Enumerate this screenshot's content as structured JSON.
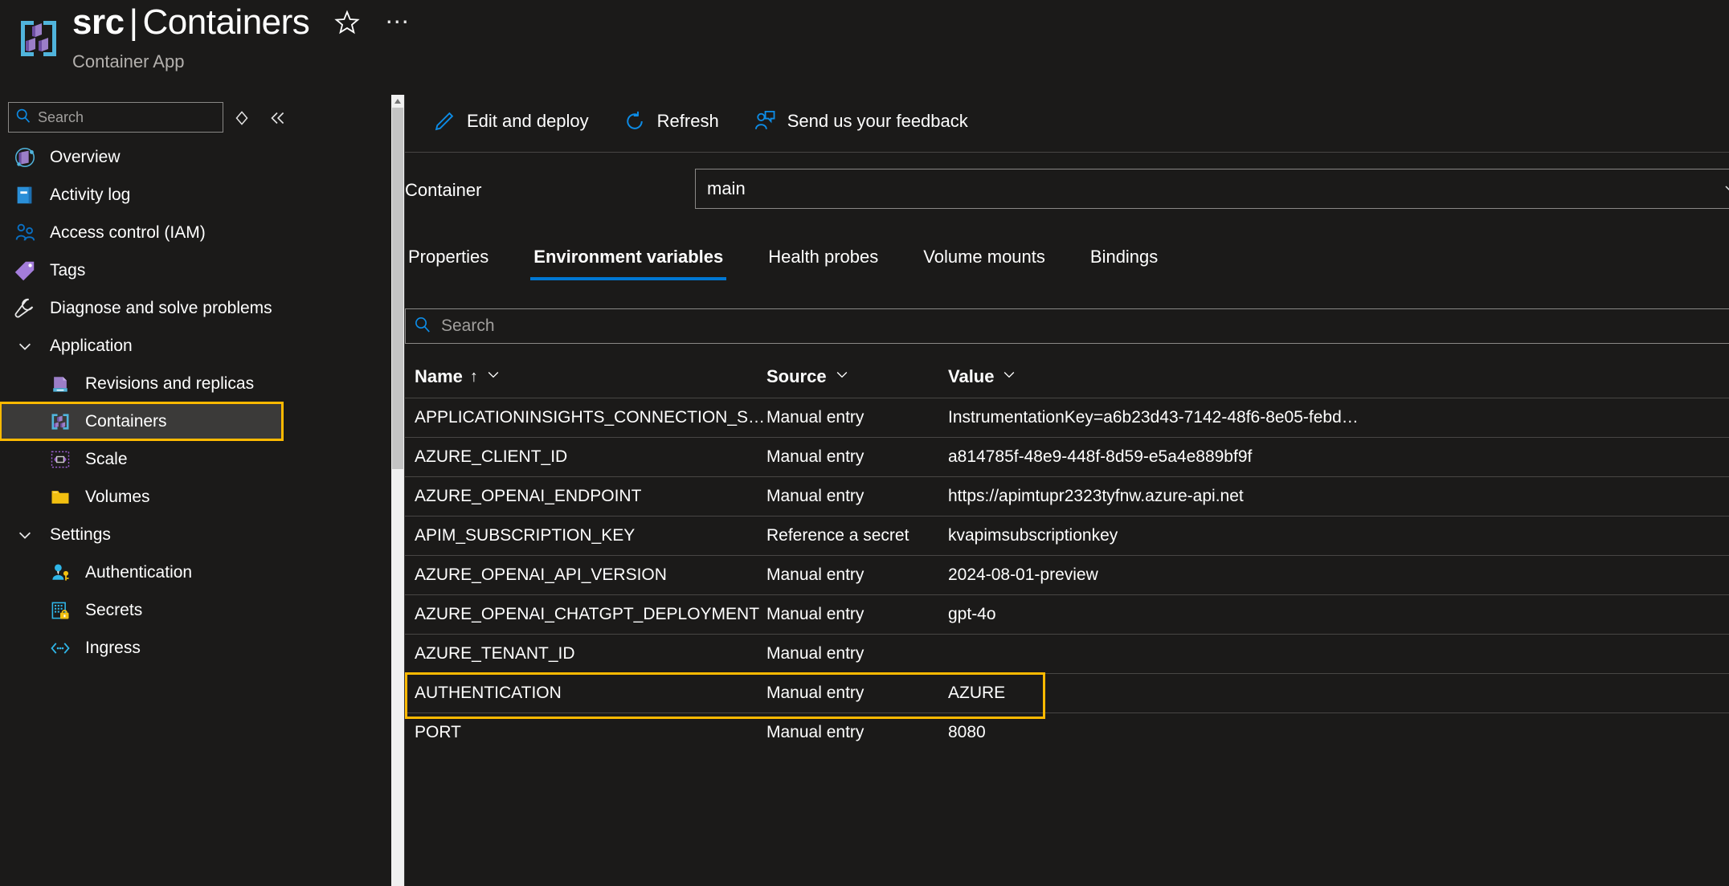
{
  "header": {
    "resource_name": "src",
    "separator": "|",
    "page_name": "Containers",
    "subtitle": "Container App",
    "favorite_icon": "star-icon",
    "more_icon": "ellipsis-icon"
  },
  "sidebar": {
    "search": {
      "placeholder": "Search",
      "value": "",
      "icon": "search-icon"
    },
    "sort_icon": "diamond-sort-icon",
    "collapse_icon": "double-chevron-left-icon",
    "items": [
      {
        "label": "Overview",
        "icon": "overview-icon",
        "type": "item",
        "selected": false
      },
      {
        "label": "Activity log",
        "icon": "activity-log-icon",
        "type": "item",
        "selected": false
      },
      {
        "label": "Access control (IAM)",
        "icon": "access-control-icon",
        "type": "item",
        "selected": false
      },
      {
        "label": "Tags",
        "icon": "tags-icon",
        "type": "item",
        "selected": false
      },
      {
        "label": "Diagnose and solve problems",
        "icon": "diagnose-icon",
        "type": "item",
        "selected": false
      },
      {
        "label": "Application",
        "icon": "chevron-down-icon",
        "type": "group",
        "selected": false
      },
      {
        "label": "Revisions and replicas",
        "icon": "revisions-icon",
        "type": "child",
        "selected": false
      },
      {
        "label": "Containers",
        "icon": "containers-icon",
        "type": "child",
        "selected": true
      },
      {
        "label": "Scale",
        "icon": "scale-icon",
        "type": "child",
        "selected": false
      },
      {
        "label": "Volumes",
        "icon": "volumes-icon",
        "type": "child",
        "selected": false
      },
      {
        "label": "Settings",
        "icon": "chevron-down-icon",
        "type": "group",
        "selected": false
      },
      {
        "label": "Authentication",
        "icon": "authentication-icon",
        "type": "child",
        "selected": false
      },
      {
        "label": "Secrets",
        "icon": "secrets-icon",
        "type": "child",
        "selected": false
      },
      {
        "label": "Ingress",
        "icon": "ingress-icon",
        "type": "child",
        "selected": false
      }
    ]
  },
  "toolbar": {
    "buttons": [
      {
        "label": "Edit and deploy",
        "icon": "pencil-icon"
      },
      {
        "label": "Refresh",
        "icon": "refresh-icon"
      },
      {
        "label": "Send us your feedback",
        "icon": "feedback-person-icon"
      }
    ]
  },
  "container_selector": {
    "label": "Container",
    "value": "main",
    "chevron_icon": "chevron-down-icon"
  },
  "tabs": [
    {
      "label": "Properties",
      "active": false
    },
    {
      "label": "Environment variables",
      "active": true
    },
    {
      "label": "Health probes",
      "active": false
    },
    {
      "label": "Volume mounts",
      "active": false
    },
    {
      "label": "Bindings",
      "active": false
    }
  ],
  "table": {
    "search": {
      "placeholder": "Search",
      "value": "",
      "icon": "search-icon"
    },
    "columns": [
      {
        "label": "Name",
        "sort": "↑",
        "filter_icon": "chevron-down-icon"
      },
      {
        "label": "Source",
        "sort": "",
        "filter_icon": "chevron-down-icon"
      },
      {
        "label": "Value",
        "sort": "",
        "filter_icon": "chevron-down-icon"
      }
    ],
    "rows": [
      {
        "name": "APPLICATIONINSIGHTS_CONNECTION_STRING",
        "source": "Manual entry",
        "value": "InstrumentationKey=a6b23d43-7142-48f6-8e05-febd…",
        "highlight": false
      },
      {
        "name": "AZURE_CLIENT_ID",
        "source": "Manual entry",
        "value": "a814785f-48e9-448f-8d59-e5a4e889bf9f",
        "highlight": false
      },
      {
        "name": "AZURE_OPENAI_ENDPOINT",
        "source": "Manual entry",
        "value": "https://apimtupr2323tyfnw.azure-api.net",
        "highlight": false
      },
      {
        "name": "APIM_SUBSCRIPTION_KEY",
        "source": "Reference a secret",
        "value": "kvapimsubscriptionkey",
        "highlight": false
      },
      {
        "name": "AZURE_OPENAI_API_VERSION",
        "source": "Manual entry",
        "value": "2024-08-01-preview",
        "highlight": false
      },
      {
        "name": "AZURE_OPENAI_CHATGPT_DEPLOYMENT",
        "source": "Manual entry",
        "value": "gpt-4o",
        "highlight": false
      },
      {
        "name": "AZURE_TENANT_ID",
        "source": "Manual entry",
        "value": "",
        "highlight": false
      },
      {
        "name": "AUTHENTICATION",
        "source": "Manual entry",
        "value": "AZURE",
        "highlight": true
      },
      {
        "name": "PORT",
        "source": "Manual entry",
        "value": "8080",
        "highlight": false
      }
    ]
  },
  "colors": {
    "background": "#1b1a19",
    "accent_blue": "#0078d4",
    "highlight_yellow": "#ffb900",
    "selected_row_bg": "#3b3a39",
    "border": "#8a8886",
    "divider": "#484644"
  }
}
